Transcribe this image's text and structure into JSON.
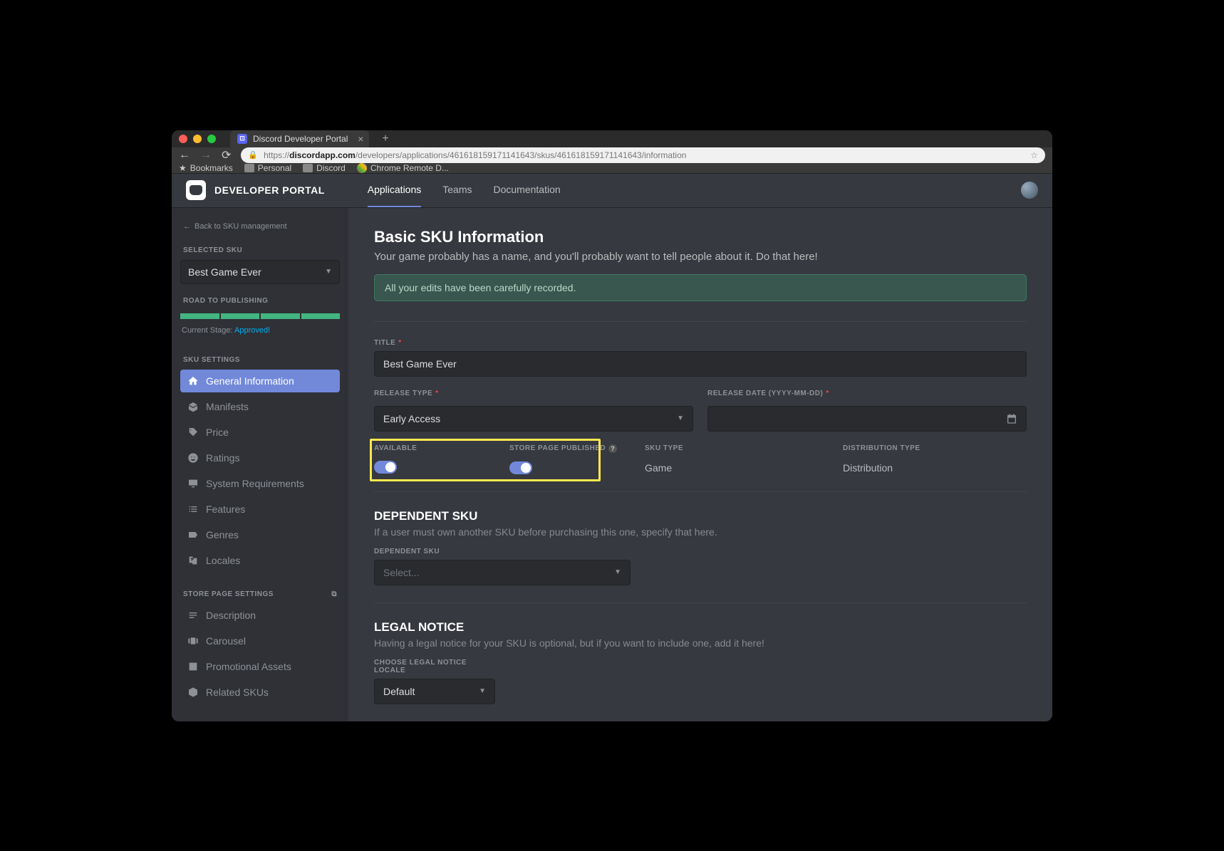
{
  "browser": {
    "tab_title": "Discord Developer Portal",
    "url_host": "discordapp.com",
    "url_path": "/developers/applications/461618159171141643/skus/461618159171141643/information",
    "bookmarks": [
      "Bookmarks",
      "Personal",
      "Discord",
      "Chrome Remote D..."
    ]
  },
  "header": {
    "brand": "DEVELOPER PORTAL",
    "nav": [
      "Applications",
      "Teams",
      "Documentation"
    ]
  },
  "sidebar": {
    "back": "Back to SKU management",
    "selected_sku_label": "SELECTED SKU",
    "selected_sku": "Best Game Ever",
    "road_label": "ROAD TO PUBLISHING",
    "stage_label": "Current Stage: ",
    "stage_value": "Approved!",
    "sku_settings_label": "SKU SETTINGS",
    "sku_items": [
      "General Information",
      "Manifests",
      "Price",
      "Ratings",
      "System Requirements",
      "Features",
      "Genres",
      "Locales"
    ],
    "store_settings_label": "STORE PAGE SETTINGS",
    "store_items": [
      "Description",
      "Carousel",
      "Promotional Assets",
      "Related SKUs"
    ]
  },
  "main": {
    "title": "Basic SKU Information",
    "subtitle": "Your game probably has a name, and you'll probably want to tell people about it. Do that here!",
    "banner": "All your edits have been carefully recorded.",
    "form": {
      "title_label": "TITLE",
      "title_value": "Best Game Ever",
      "release_type_label": "RELEASE TYPE",
      "release_type_value": "Early Access",
      "release_date_label": "RELEASE DATE (YYYY-MM-DD)",
      "release_date_value": "",
      "available_label": "AVAILABLE",
      "store_pub_label": "STORE PAGE PUBLISHED",
      "sku_type_label": "SKU TYPE",
      "sku_type_value": "Game",
      "dist_type_label": "DISTRIBUTION TYPE",
      "dist_type_value": "Distribution"
    },
    "dependent": {
      "heading": "DEPENDENT SKU",
      "sub": "If a user must own another SKU before purchasing this one, specify that here.",
      "label": "DEPENDENT SKU",
      "placeholder": "Select..."
    },
    "legal": {
      "heading": "LEGAL NOTICE",
      "sub": "Having a legal notice for your SKU is optional, but if you want to include one, add it here!",
      "label": "CHOOSE LEGAL NOTICE LOCALE",
      "value": "Default"
    }
  }
}
